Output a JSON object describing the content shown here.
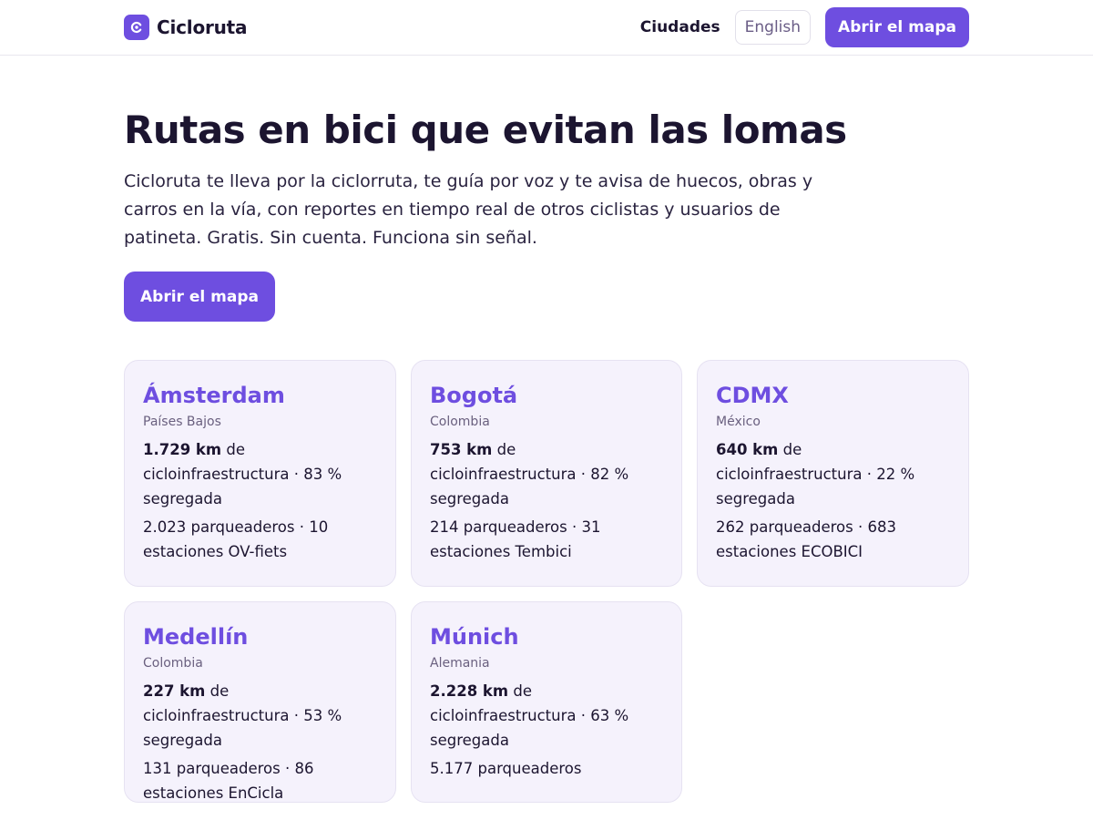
{
  "header": {
    "brand": "Cicloruta",
    "nav_cities": "Ciudades",
    "lang_button": "English",
    "cta": "Abrir el mapa"
  },
  "hero": {
    "title": "Rutas en bici que evitan las lomas",
    "lead": "Cicloruta te lleva por la ciclorruta, te guía por voz y te avisa de huecos, obras y carros en la vía, con reportes en tiempo real de otros ciclistas y usuarios de patineta. Gratis. Sin cuenta. Funciona sin señal.",
    "cta": "Abrir el mapa"
  },
  "cities": [
    {
      "name": "Ámsterdam",
      "country": "Países Bajos",
      "km": "1.729 km",
      "infra_text": " de cicloinfraestructura · 83 % segregada",
      "parking": "2.023 parqueaderos · 10 estaciones OV-fiets"
    },
    {
      "name": "Bogotá",
      "country": "Colombia",
      "km": "753 km",
      "infra_text": " de cicloinfraestructura · 82 % segregada",
      "parking": "214 parqueaderos · 31 estaciones Tembici"
    },
    {
      "name": "CDMX",
      "country": "México",
      "km": "640 km",
      "infra_text": " de cicloinfraestructura · 22 % segregada",
      "parking": "262 parqueaderos · 683 estaciones ECOBICI"
    },
    {
      "name": "Medellín",
      "country": "Colombia",
      "km": "227 km",
      "infra_text": " de cicloinfraestructura · 53 % segregada",
      "parking": "131 parqueaderos · 86 estaciones EnCicla"
    },
    {
      "name": "Múnich",
      "country": "Alemania",
      "km": "2.228 km",
      "infra_text": " de cicloinfraestructura · 63 % segregada",
      "parking": "5.177 parqueaderos"
    }
  ],
  "colors": {
    "accent": "#6e4ee0",
    "card_bg": "#f5f2fc",
    "text": "#1c1530"
  },
  "icons": {
    "brand_logo": "refresh-icon"
  }
}
